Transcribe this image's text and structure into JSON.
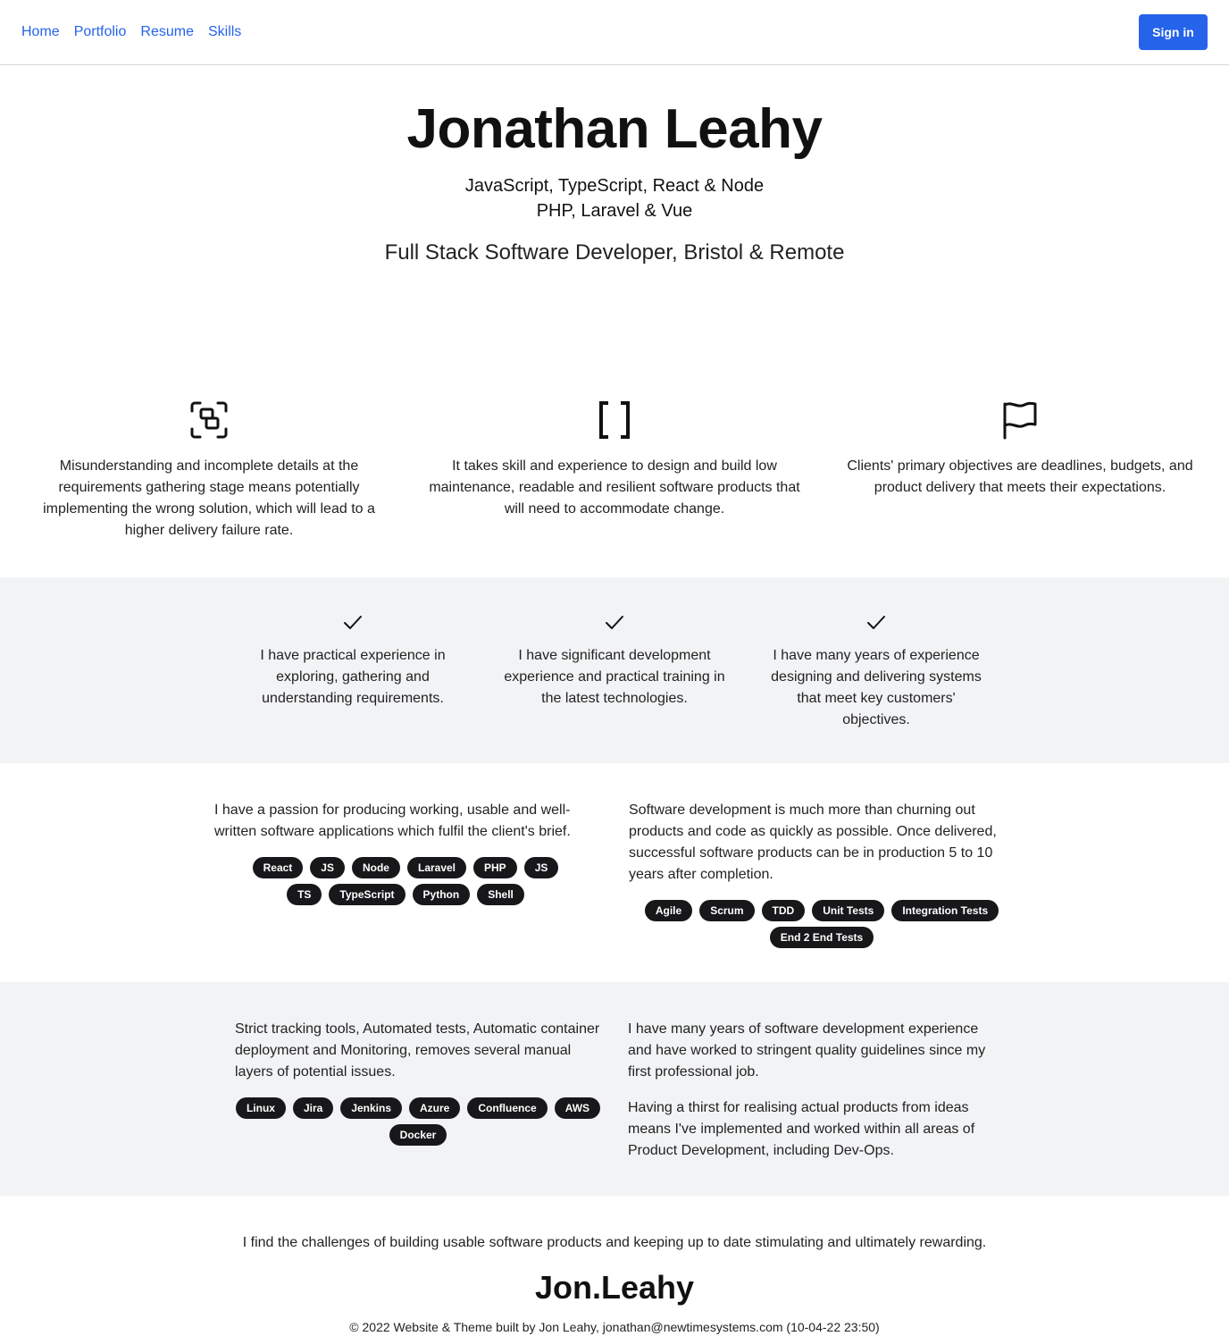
{
  "nav": {
    "links": [
      "Home",
      "Portfolio",
      "Resume",
      "Skills"
    ],
    "sign_in": "Sign in"
  },
  "hero": {
    "name": "Jonathan Leahy",
    "stack_line1": "JavaScript, TypeScript, React & Node",
    "stack_line2": "PHP, Laravel & Vue",
    "role": "Full Stack Software Developer, Bristol & Remote"
  },
  "features": [
    {
      "icon": "requirements-icon",
      "text": "Misunderstanding and incomplete details at the requirements gathering stage means potentially implementing the wrong solution, which will lead to a higher delivery failure rate."
    },
    {
      "icon": "brackets-icon",
      "text": "It takes skill and experience to design and build low maintenance, readable and resilient software products that will need to accommodate change."
    },
    {
      "icon": "flag-icon",
      "text": "Clients' primary objectives are deadlines, budgets, and product delivery that meets their expectations."
    }
  ],
  "checks": [
    {
      "icon": "check-icon",
      "text": "I have practical experience in exploring, gathering and understanding requirements."
    },
    {
      "icon": "check-icon",
      "text": "I have significant development experience and practical training in the latest technologies."
    },
    {
      "icon": "check-icon",
      "text": "I have many years of experience designing and delivering systems that meet key customers' objectives."
    }
  ],
  "section1": {
    "left_text": "I have a passion for producing working, usable and well-written software applications which fulfil the client's brief.",
    "left_tags": [
      "React",
      "JS",
      "Node",
      "Laravel",
      "PHP",
      "JS",
      "TS",
      "TypeScript",
      "Python",
      "Shell"
    ],
    "right_text": "Software development is much more than churning out products and code as quickly as possible. Once delivered, successful software products can be in production 5 to 10 years after completion.",
    "right_tags": [
      "Agile",
      "Scrum",
      "TDD",
      "Unit Tests",
      "Integration Tests",
      "End 2 End Tests"
    ]
  },
  "section2": {
    "left_text": "Strict tracking tools, Automated tests, Automatic container deployment and Monitoring, removes several manual layers of potential issues.",
    "left_tags": [
      "Linux",
      "Jira",
      "Jenkins",
      "Azure",
      "Confluence",
      "AWS",
      "Docker"
    ],
    "right_para1": "I have many years of software development experience and have worked to stringent quality guidelines since my first professional job.",
    "right_para2": "Having a thirst for realising actual products from ideas means I've implemented and worked within all areas of Product Development, including Dev-Ops."
  },
  "closing": {
    "statement": "I find the challenges of building usable software products and keeping up to date stimulating and ultimately rewarding.",
    "logo": "Jon.Leahy",
    "footer": "© 2022 Website & Theme built by Jon Leahy, jonathan@newtimesystems.com (10-04-22 23:50)"
  },
  "colors": {
    "accent": "#2563eb",
    "tag_bg": "#18181b",
    "band_bg": "#f2f3f5"
  }
}
